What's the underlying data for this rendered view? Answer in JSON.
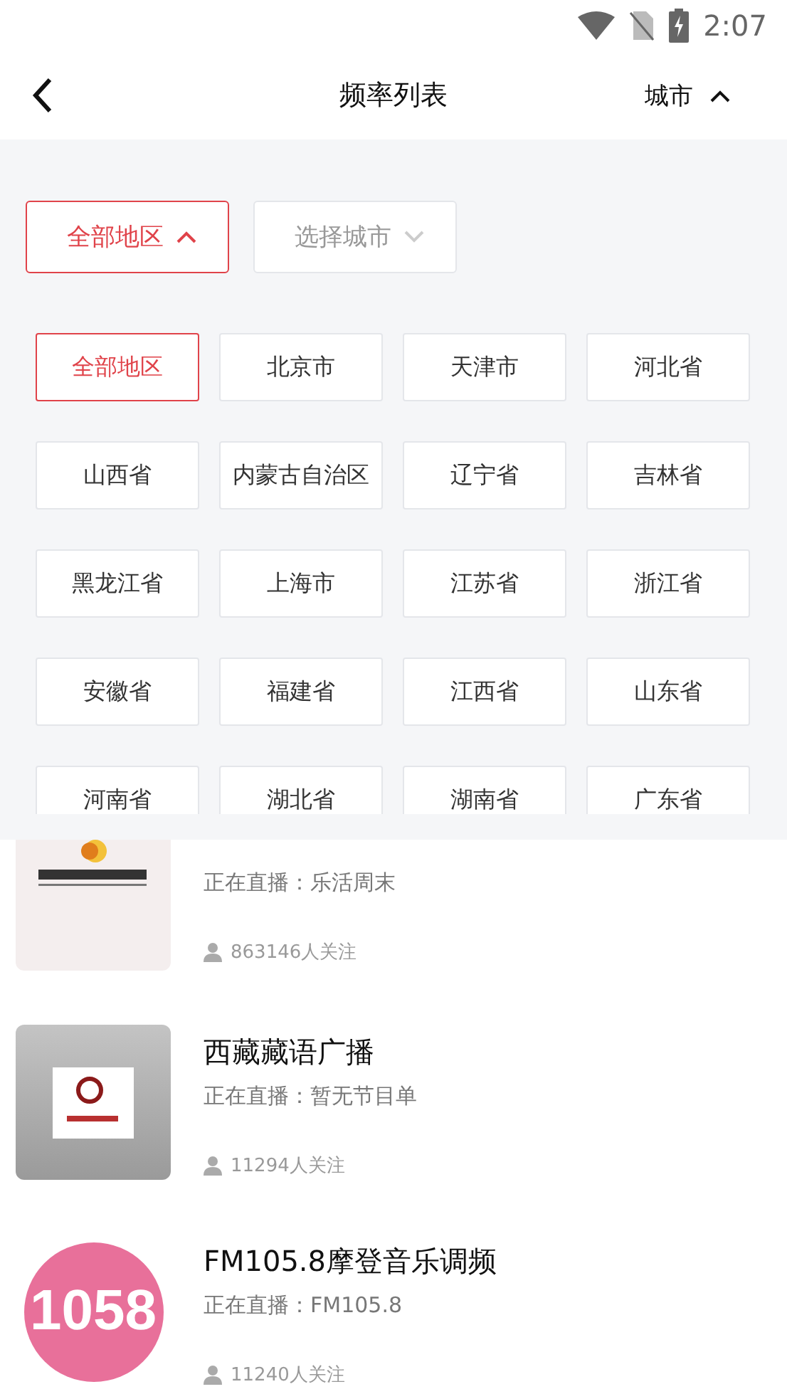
{
  "status_bar": {
    "time": "2:07"
  },
  "header": {
    "title": "频率列表",
    "right_label": "城市",
    "right_expanded": true
  },
  "filters": [
    {
      "label": "全部地区",
      "selected": true,
      "expanded": true
    },
    {
      "label": "选择城市",
      "selected": false,
      "expanded": false
    }
  ],
  "regions": [
    {
      "label": "全部地区",
      "selected": true
    },
    {
      "label": "北京市",
      "selected": false
    },
    {
      "label": "天津市",
      "selected": false
    },
    {
      "label": "河北省",
      "selected": false
    },
    {
      "label": "山西省",
      "selected": false
    },
    {
      "label": "内蒙古自治区",
      "selected": false
    },
    {
      "label": "辽宁省",
      "selected": false
    },
    {
      "label": "吉林省",
      "selected": false
    },
    {
      "label": "黑龙江省",
      "selected": false
    },
    {
      "label": "上海市",
      "selected": false
    },
    {
      "label": "江苏省",
      "selected": false
    },
    {
      "label": "浙江省",
      "selected": false
    },
    {
      "label": "安徽省",
      "selected": false
    },
    {
      "label": "福建省",
      "selected": false
    },
    {
      "label": "江西省",
      "selected": false
    },
    {
      "label": "山东省",
      "selected": false
    },
    {
      "label": "河南省",
      "selected": false
    },
    {
      "label": "湖北省",
      "selected": false
    },
    {
      "label": "湖南省",
      "selected": false
    },
    {
      "label": "广东省",
      "selected": false
    }
  ],
  "stations": [
    {
      "live": "正在直播：乐活周末",
      "followers": "863146人关注"
    },
    {
      "title": "西藏藏语广播",
      "live": "正在直播：暂无节目单",
      "followers": "11294人关注"
    },
    {
      "title": "FM105.8摩登音乐调频",
      "live": "正在直播：FM105.8",
      "followers": "11240人关注",
      "logo": {
        "kind": "badge",
        "text": "1058"
      }
    }
  ]
}
